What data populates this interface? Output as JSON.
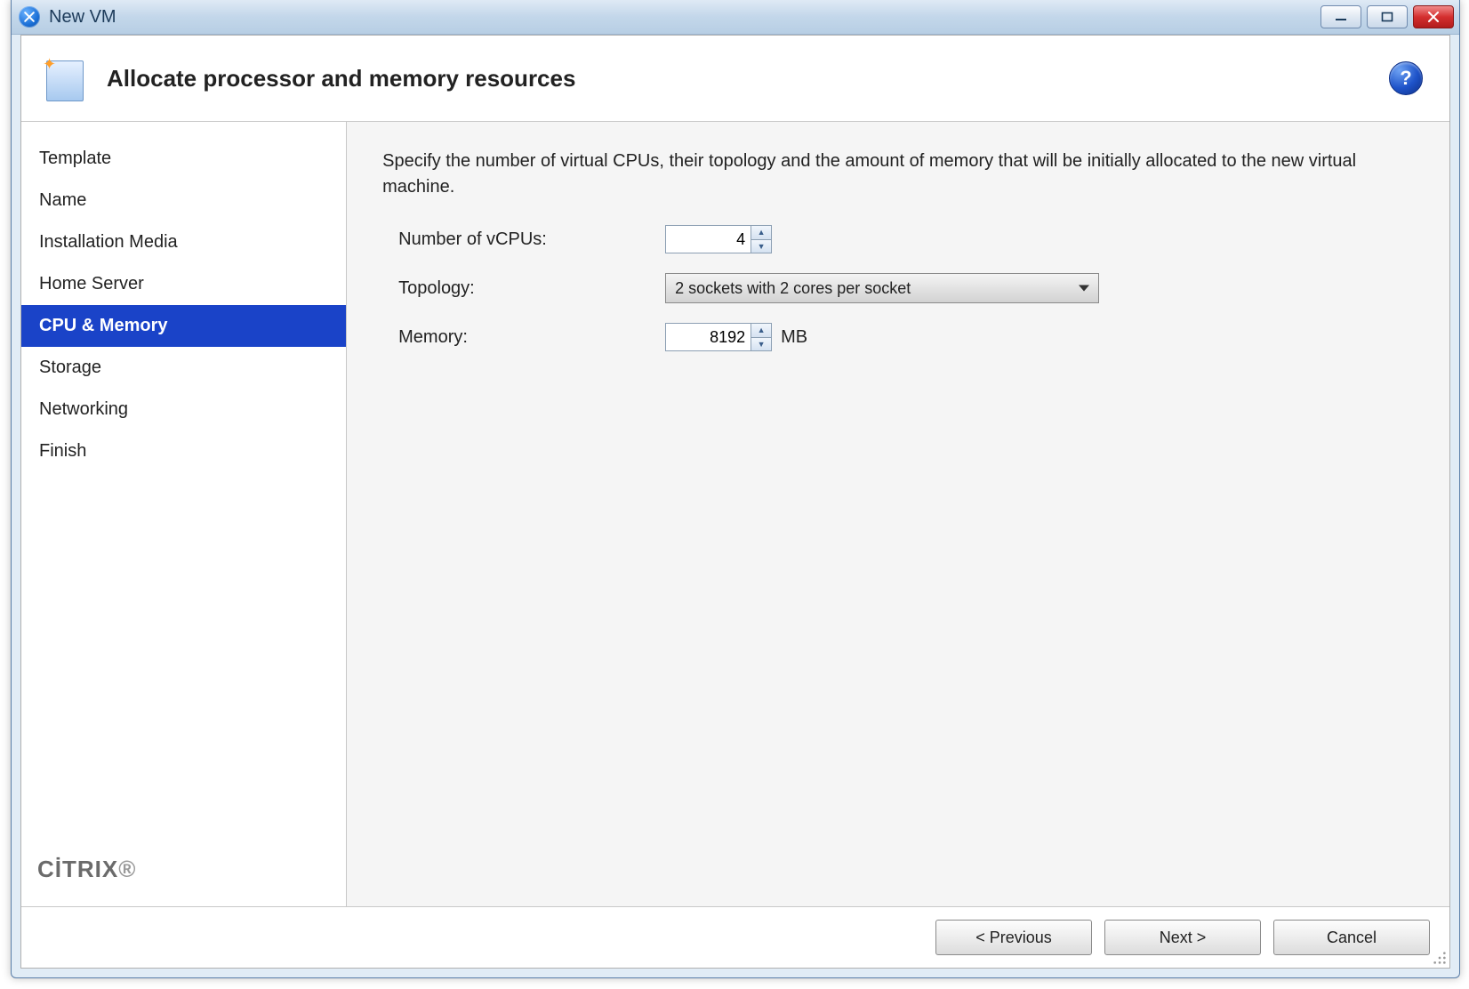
{
  "window": {
    "title": "New VM"
  },
  "header": {
    "title": "Allocate processor and memory resources"
  },
  "sidebar": {
    "items": [
      {
        "label": "Template",
        "selected": false
      },
      {
        "label": "Name",
        "selected": false
      },
      {
        "label": "Installation Media",
        "selected": false
      },
      {
        "label": "Home Server",
        "selected": false
      },
      {
        "label": "CPU & Memory",
        "selected": true
      },
      {
        "label": "Storage",
        "selected": false
      },
      {
        "label": "Networking",
        "selected": false
      },
      {
        "label": "Finish",
        "selected": false
      }
    ],
    "brand": "CİTRIX"
  },
  "pane": {
    "description": "Specify the number of virtual CPUs, their topology and the amount of memory that will be initially allocated to the new virtual machine.",
    "vcpu": {
      "label": "Number of vCPUs:",
      "value": "4"
    },
    "topology": {
      "label": "Topology:",
      "value": "2 sockets with 2 cores per socket"
    },
    "memory": {
      "label": "Memory:",
      "value": "8192",
      "unit": "MB"
    }
  },
  "footer": {
    "previous": "< Previous",
    "next": "Next >",
    "cancel": "Cancel"
  }
}
